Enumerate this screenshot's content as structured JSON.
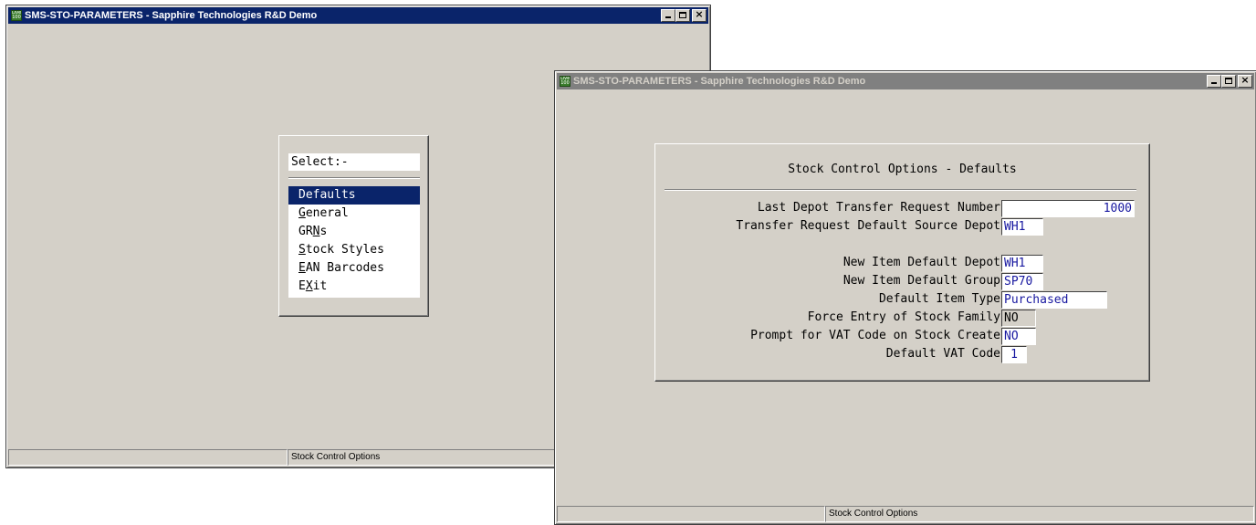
{
  "window1": {
    "title": "SMS-STO-PARAMETERS - Sapphire Technologies R&D Demo",
    "icon_label": "Live 100",
    "menu": {
      "header": "Select:-",
      "items": [
        {
          "label": "Defaults"
        },
        {
          "pre": "",
          "ul": "G",
          "post": "eneral"
        },
        {
          "pre": "GR",
          "ul": "N",
          "post": "s"
        },
        {
          "pre": "",
          "ul": "S",
          "post": "tock Styles"
        },
        {
          "pre": "",
          "ul": "E",
          "post": "AN Barcodes"
        },
        {
          "pre": "E",
          "ul": "X",
          "post": "it"
        }
      ]
    },
    "status": "Stock Control Options"
  },
  "window2": {
    "title": "SMS-STO-PARAMETERS - Sapphire Technologies R&D Demo",
    "icon_label": "Live 100",
    "form_title": "Stock Control Options - Defaults",
    "fields": {
      "last_depot_transfer": {
        "label": "Last Depot Transfer Request Number",
        "value": "1000"
      },
      "transfer_default_depot": {
        "label": "Transfer Request Default Source Depot",
        "value": "WH1"
      },
      "new_item_depot": {
        "label": "New Item Default Depot",
        "value": "WH1"
      },
      "new_item_group": {
        "label": "New Item Default Group",
        "value": "SP70"
      },
      "default_item_type": {
        "label": "Default Item Type",
        "value": "Purchased"
      },
      "force_stock_family": {
        "label": "Force Entry of Stock Family",
        "value": "NO"
      },
      "prompt_vat": {
        "label": "Prompt for VAT Code on Stock Create",
        "value": "NO"
      },
      "default_vat": {
        "label": "Default VAT Code",
        "value": "1"
      }
    },
    "status": "Stock Control Options"
  }
}
